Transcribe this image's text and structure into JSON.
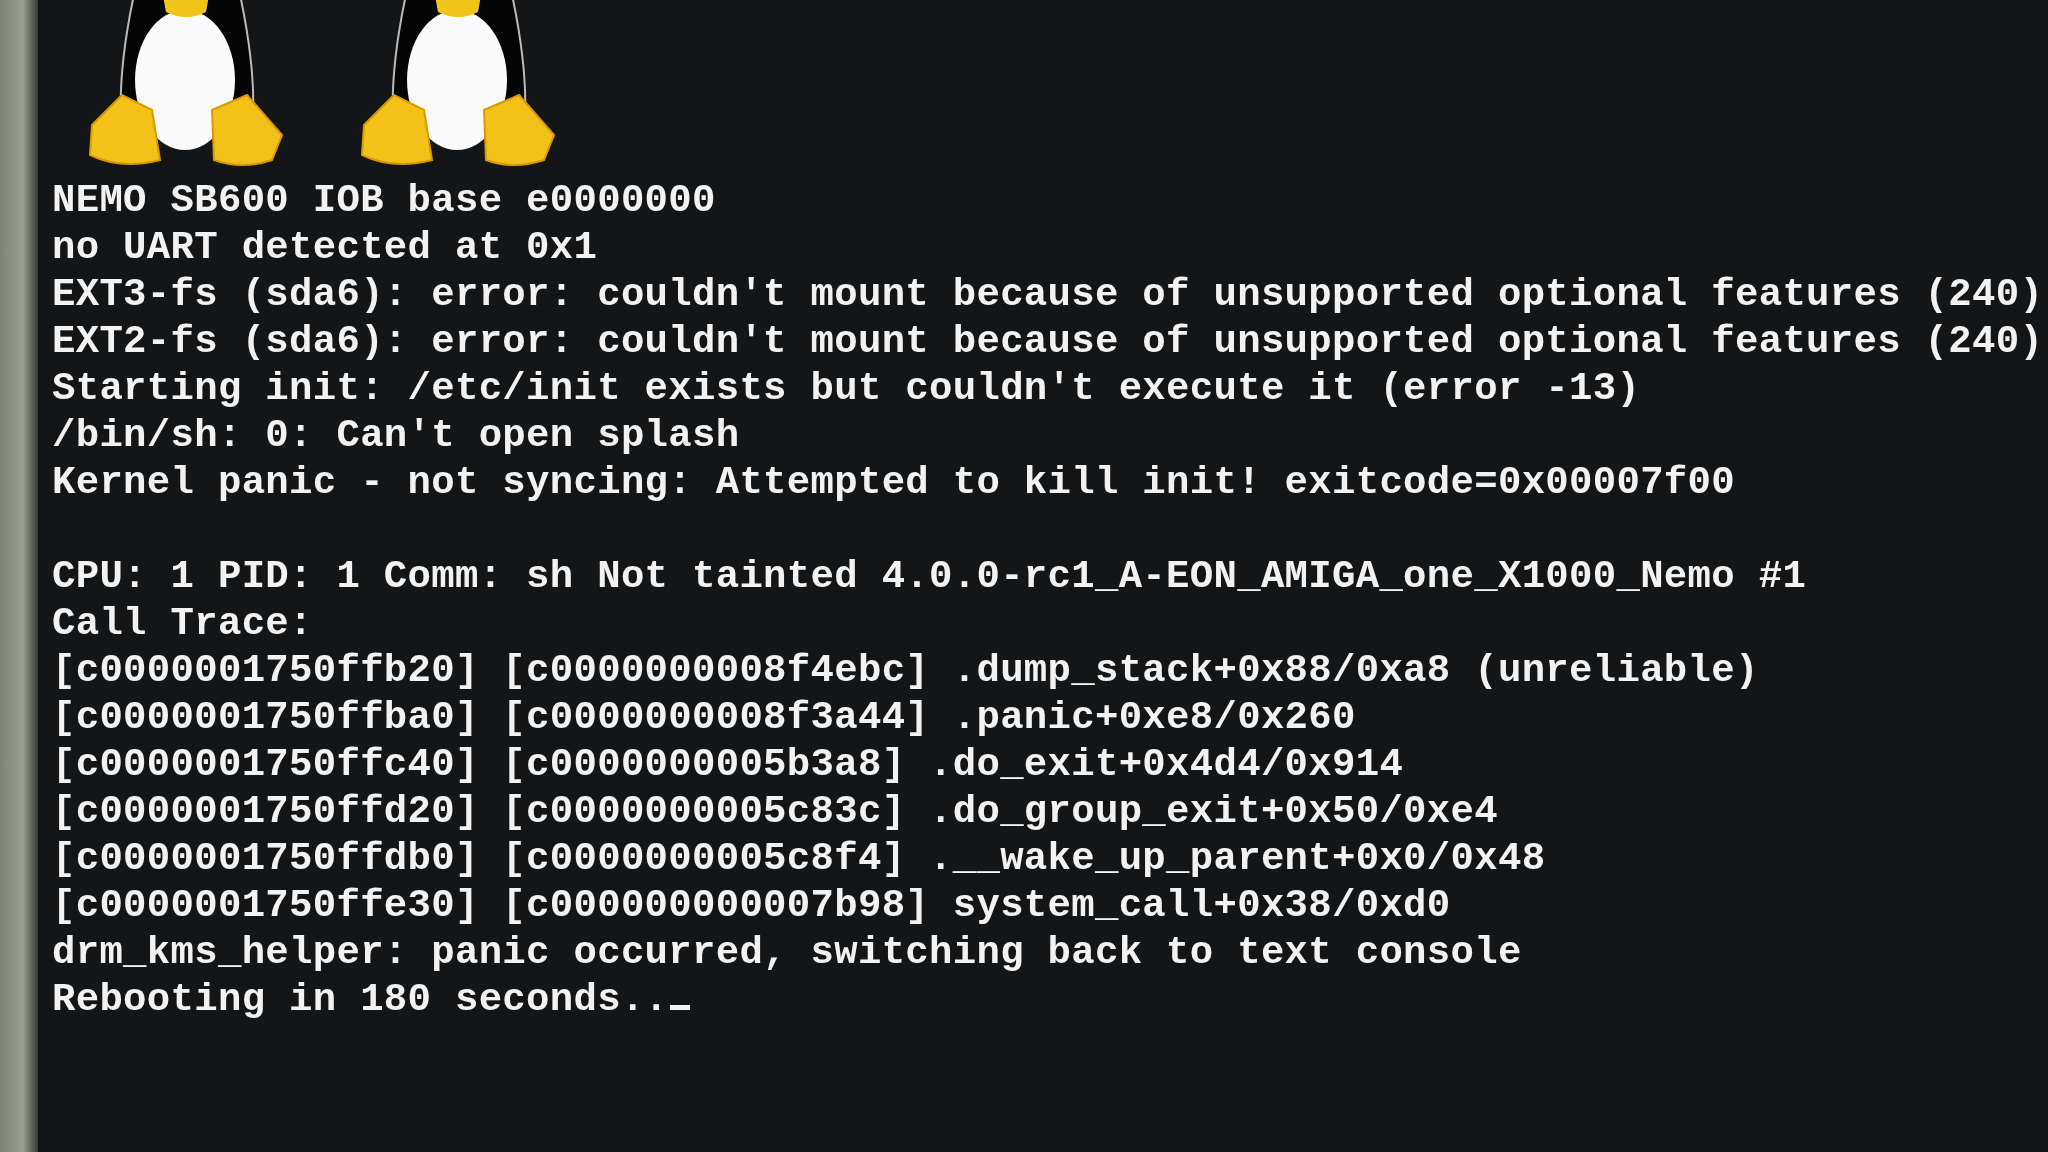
{
  "console": {
    "blocks": [
      [
        "NEMO SB600 IOB base e0000000",
        "no UART detected at 0x1",
        "EXT3-fs (sda6): error: couldn't mount because of unsupported optional features (240)",
        "EXT2-fs (sda6): error: couldn't mount because of unsupported optional features (240)",
        "Starting init: /etc/init exists but couldn't execute it (error -13)",
        "/bin/sh: 0: Can't open splash",
        "Kernel panic - not syncing: Attempted to kill init! exitcode=0x00007f00"
      ],
      [
        "CPU: 1 PID: 1 Comm: sh Not tainted 4.0.0-rc1_A-EON_AMIGA_one_X1000_Nemo #1",
        "Call Trace:",
        "[c0000001750ffb20] [c0000000008f4ebc] .dump_stack+0x88/0xa8 (unreliable)",
        "[c0000001750ffba0] [c0000000008f3a44] .panic+0xe8/0x260",
        "[c0000001750ffc40] [c0000000005b3a8] .do_exit+0x4d4/0x914",
        "[c0000001750ffd20] [c0000000005c83c] .do_group_exit+0x50/0xe4",
        "[c0000001750ffdb0] [c0000000005c8f4] .__wake_up_parent+0x0/0x48",
        "[c0000001750ffe30] [c000000000007b98] system_call+0x38/0xd0",
        "drm_kms_helper: panic occurred, switching back to text console",
        "Rebooting in 180 seconds.."
      ]
    ],
    "cursor_visible": true
  }
}
